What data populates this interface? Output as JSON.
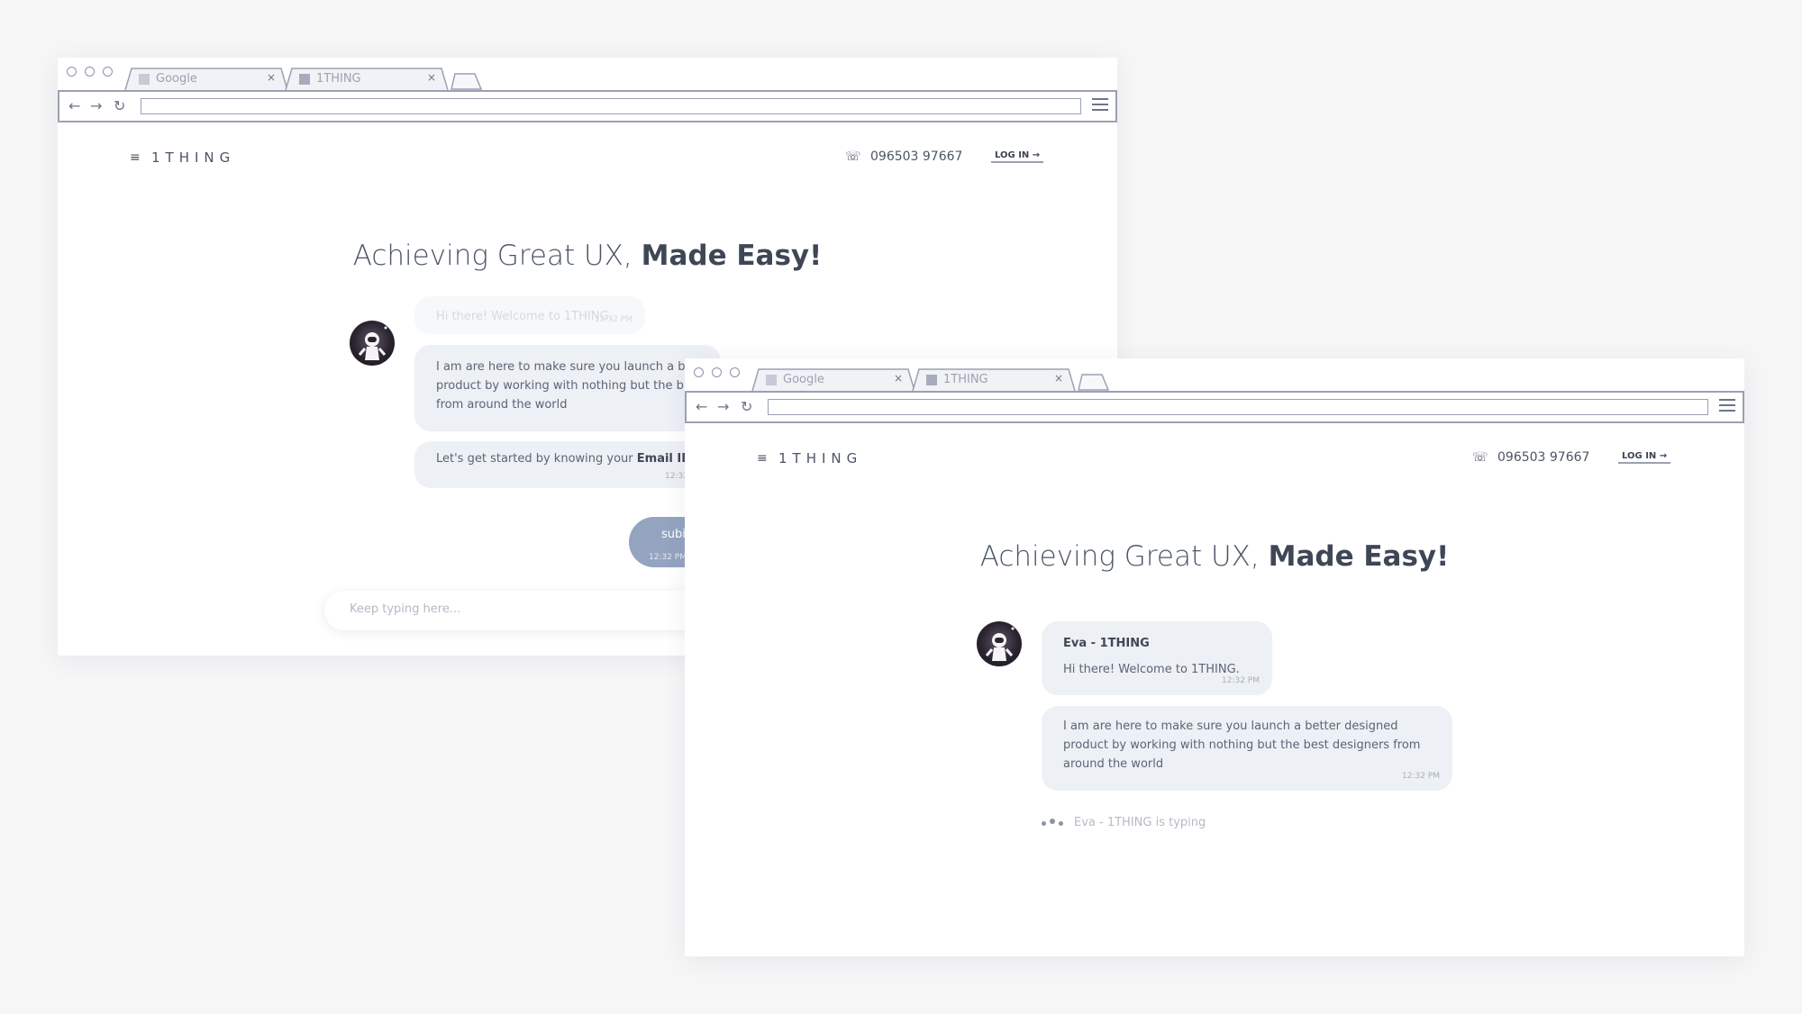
{
  "browser": {
    "tabs": [
      {
        "label": "Google",
        "close": "×"
      },
      {
        "label": "1THING",
        "close": "×"
      }
    ]
  },
  "site": {
    "menu_icon": "≡",
    "logo": "1THING",
    "phone_icon": "☏",
    "phone": "096503 97667",
    "login": "LOG IN →",
    "headline_light": "Achieving Great UX,",
    "headline_bold": "Made Easy!"
  },
  "back_chat": {
    "messages": [
      {
        "text": "Hi there! Welcome to 1THING.",
        "time": "12:32 PM"
      },
      {
        "text": "I am are here to make sure you launch a be product by working with nothing but the b from around the world"
      },
      {
        "text_plain": "Let's get started by knowing your",
        "text_bold": "Email ID",
        "time": "12:32"
      }
    ],
    "user_reply": {
      "text": "subi",
      "time": "12:32 PM"
    },
    "input_placeholder": "Keep typing here..."
  },
  "front_chat": {
    "agent_name": "Eva - 1THING",
    "messages": [
      {
        "text": "Hi there! Welcome to 1THING.",
        "time": "12:32 PM"
      },
      {
        "text": "I am are here to make sure you launch a better designed product by working with nothing but the best designers from around the world",
        "time": "12:32 PM"
      }
    ],
    "typing": "Eva - 1THING is typing"
  },
  "colors": {
    "page_bg": "#f6f6f7",
    "bubble_bg": "#edf0f5",
    "user_bubble": "#94a4c0",
    "text": "#4b5565"
  }
}
